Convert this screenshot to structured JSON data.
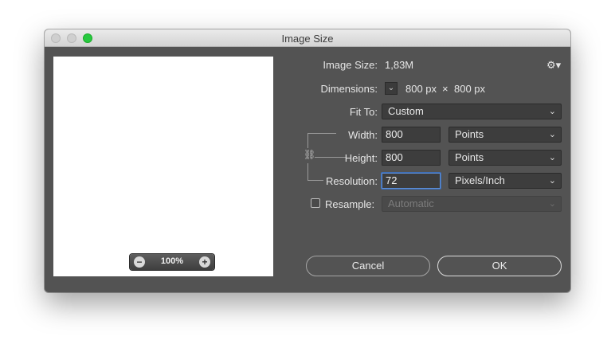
{
  "window": {
    "title": "Image Size"
  },
  "preview": {
    "zoom_value": "100%"
  },
  "info": {
    "image_size_label": "Image Size:",
    "image_size_value": "1,83M",
    "dimensions_label": "Dimensions:",
    "dimensions_width": "800 px",
    "dimensions_sep": "×",
    "dimensions_height": "800 px"
  },
  "fit_to": {
    "label": "Fit To:",
    "value": "Custom"
  },
  "width": {
    "label": "Width:",
    "value": "800",
    "unit": "Points"
  },
  "height": {
    "label": "Height:",
    "value": "800",
    "unit": "Points"
  },
  "resolution": {
    "label": "Resolution:",
    "value": "72",
    "unit": "Pixels/Inch"
  },
  "resample": {
    "label": "Resample:",
    "checked": false,
    "method": "Automatic"
  },
  "buttons": {
    "cancel": "Cancel",
    "ok": "OK"
  },
  "icons": {
    "settings": "gear-icon",
    "zoom_out": "minus-icon",
    "zoom_in": "plus-icon",
    "constrain": "chain-link-icon",
    "dropdown": "chevron-down-icon"
  }
}
